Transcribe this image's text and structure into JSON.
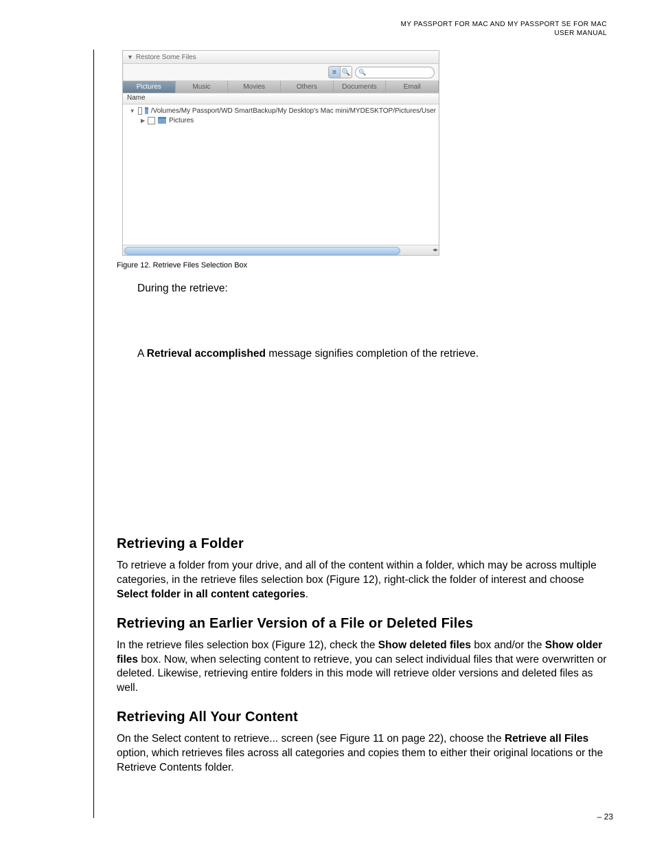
{
  "header": {
    "line1": "MY PASSPORT FOR MAC AND MY PASSPORT SE FOR MAC",
    "line2": "USER MANUAL"
  },
  "screenshot": {
    "panel_title": "Restore Some Files",
    "search_placeholder": "",
    "tabs": [
      "Pictures",
      "Music",
      "Movies",
      "Others",
      "Documents",
      "Email"
    ],
    "active_tab_index": 0,
    "column_header": "Name",
    "tree": {
      "root_path": "/Volumes/My Passport/WD SmartBackup/My Desktop's Mac mini/MYDESKTOP/Pictures/User",
      "child_label": "Pictures"
    }
  },
  "figure_caption": "Figure 12.  Retrieve Files Selection Box",
  "paragraphs": {
    "during": "During the retrieve:",
    "accomplished_prefix": "A ",
    "accomplished_bold": "Retrieval accomplished",
    "accomplished_suffix": " message signifies completion of the retrieve."
  },
  "sections": {
    "retrieving_folder": {
      "heading": "Retrieving a Folder",
      "body_a": "To retrieve a folder from your drive, and all of the content within a folder, which may be across multiple categories, in the retrieve files selection box (Figure 12), right-click the folder of interest and choose ",
      "body_bold": "Select folder in all content categories",
      "body_b": "."
    },
    "retrieving_earlier": {
      "heading": "Retrieving an Earlier Version of a File or Deleted Files",
      "body_a": "In the retrieve files selection box (Figure 12), check the ",
      "bold1": "Show deleted files",
      "body_b": " box and/or the ",
      "bold2": "Show older files",
      "body_c": " box. Now, when selecting content to retrieve, you can select individual files that were overwritten or deleted. Likewise, retrieving entire folders in this mode will retrieve older versions and deleted files as well."
    },
    "retrieving_all": {
      "heading": "Retrieving All Your Content",
      "body_a": "On the Select content to retrieve... screen (see Figure 11 on page 22), choose the ",
      "bold1": "Retrieve all Files",
      "body_b": " option, which retrieves files across all categories and copies them to either their original locations or the Retrieve Contents folder."
    }
  },
  "page_number": "– 23"
}
